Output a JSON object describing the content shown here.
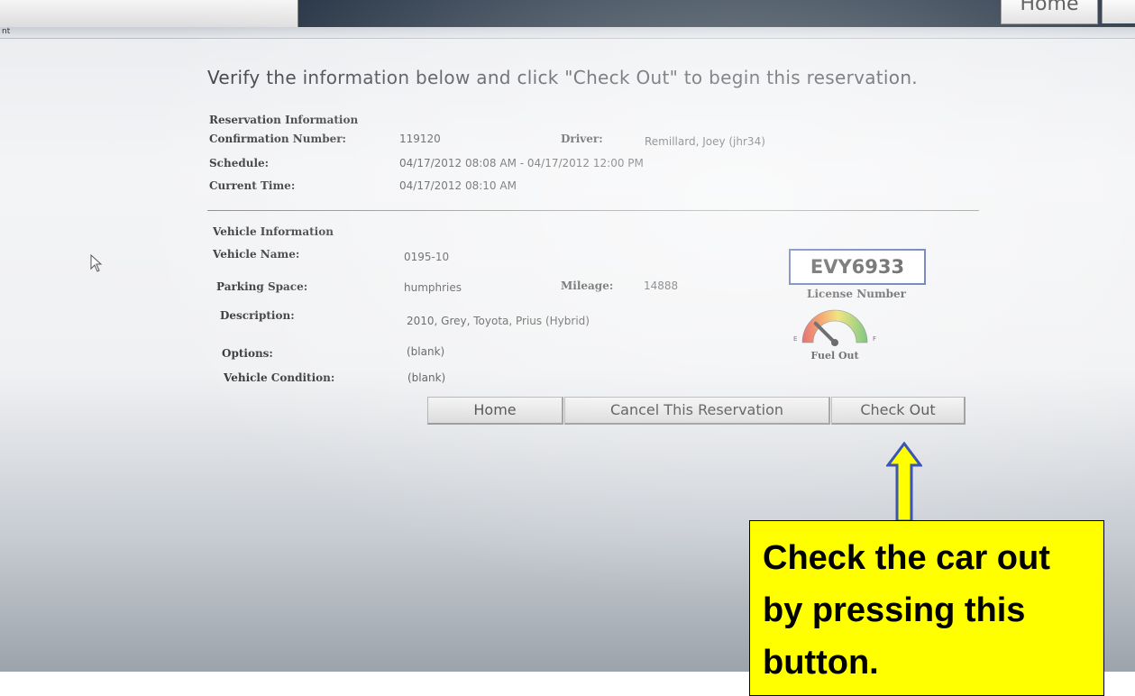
{
  "topbar": {
    "home_tab_label": "Home",
    "subbar_label": "nt"
  },
  "heading": "Verify the information below and click \"Check Out\" to begin this reservation.",
  "reservation": {
    "section_title": "Reservation Information",
    "confirmation_label": "Confirmation Number:",
    "confirmation_value": "119120",
    "driver_label": "Driver:",
    "driver_value": "Remillard, Joey (jhr34)",
    "schedule_label": "Schedule:",
    "schedule_value": "04/17/2012 08:08 AM - 04/17/2012 12:00 PM",
    "current_time_label": "Current Time:",
    "current_time_value": "04/17/2012 08:10 AM"
  },
  "vehicle": {
    "section_title": "Vehicle Information",
    "name_label": "Vehicle Name:",
    "name_value": "0195-10",
    "parking_label": "Parking Space:",
    "parking_value": "humphries",
    "mileage_label": "Mileage:",
    "mileage_value": "14888",
    "description_label": "Description:",
    "description_value": "2010, Grey, Toyota, Prius (Hybrid)",
    "options_label": "Options:",
    "options_value": "(blank)",
    "condition_label": "Vehicle Condition:",
    "condition_value": "(blank)",
    "license_plate": "EVY6933",
    "license_caption": "License Number",
    "fuel": {
      "empty_label": "E",
      "full_label": "F",
      "caption": "Fuel Out",
      "level_fraction": 0.25
    }
  },
  "buttons": {
    "home": "Home",
    "cancel": "Cancel This Reservation",
    "checkout": "Check Out"
  },
  "annotation": {
    "text": "Check the car out by pressing this button.",
    "background_color": "#ffff00",
    "arrow_color": "#ffff00",
    "arrow_outline_color": "#3a56b0"
  }
}
